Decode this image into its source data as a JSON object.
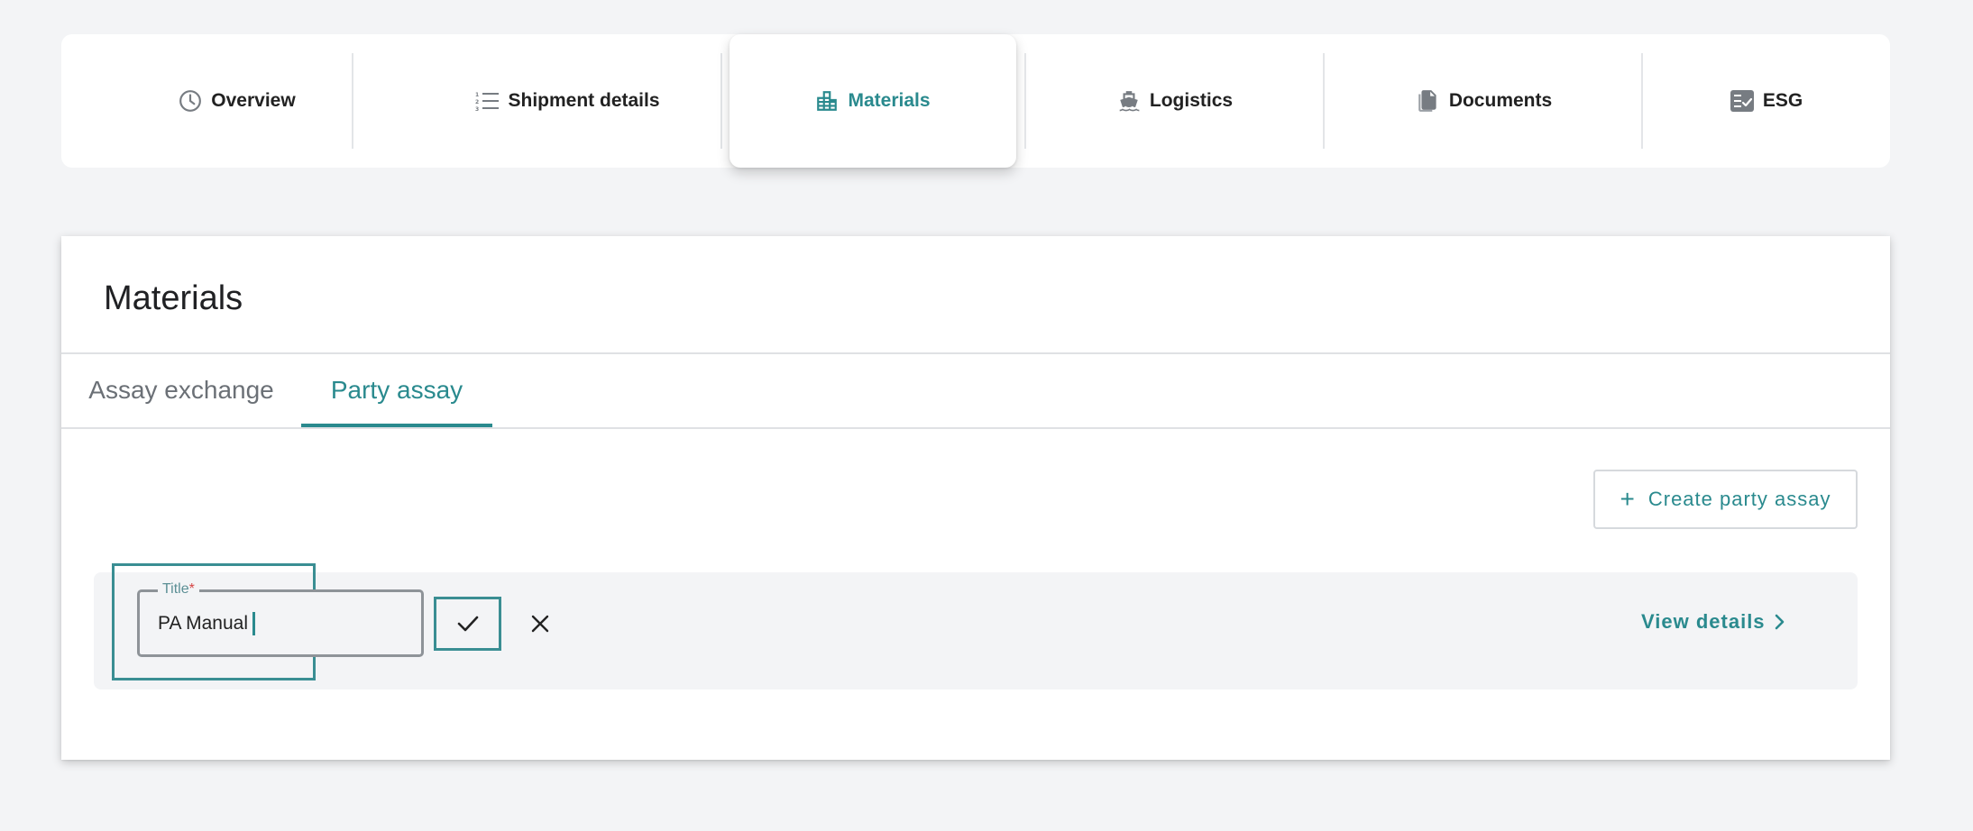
{
  "topnav": {
    "tabs": [
      {
        "label": "Overview",
        "icon": "clock-icon"
      },
      {
        "label": "Shipment details",
        "icon": "list-icon"
      },
      {
        "label": "Materials",
        "icon": "buildings-icon",
        "active": true
      },
      {
        "label": "Logistics",
        "icon": "ship-icon"
      },
      {
        "label": "Documents",
        "icon": "documents-icon"
      },
      {
        "label": "ESG",
        "icon": "checklist-icon"
      }
    ]
  },
  "card": {
    "title": "Materials",
    "subtabs": [
      {
        "label": "Assay exchange"
      },
      {
        "label": "Party assay",
        "active": true
      }
    ],
    "create_button": {
      "label": "Create party assay",
      "icon": "plus-icon"
    },
    "row": {
      "field": {
        "label": "Title",
        "required_mark": "*",
        "value": "PA Manual"
      },
      "confirm_icon": "check-icon",
      "cancel_icon": "close-icon",
      "view_details": {
        "label": "View details",
        "icon": "chevron-right-icon"
      }
    }
  },
  "colors": {
    "accent": "#2a8a8e",
    "background": "#f3f4f6",
    "required": "#d64545"
  }
}
